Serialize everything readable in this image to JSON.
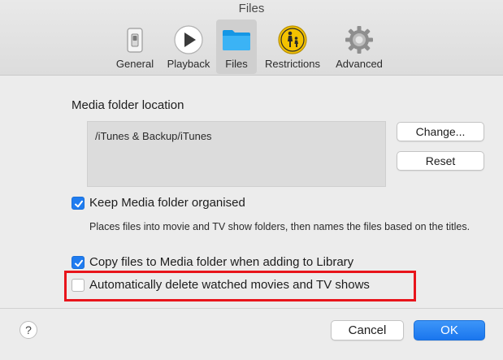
{
  "window": {
    "title": "Files"
  },
  "toolbar": {
    "tabs": [
      {
        "label": "General",
        "icon": "switch-icon"
      },
      {
        "label": "Playback",
        "icon": "play-icon"
      },
      {
        "label": "Files",
        "icon": "folder-icon",
        "selected": true
      },
      {
        "label": "Restrictions",
        "icon": "parental-restrictions-icon"
      },
      {
        "label": "Advanced",
        "icon": "gear-icon"
      }
    ]
  },
  "media_folder": {
    "label": "Media folder location",
    "path": "/iTunes & Backup/iTunes",
    "change_label": "Change...",
    "reset_label": "Reset"
  },
  "options": {
    "keep_organised": {
      "label": "Keep Media folder organised",
      "checked": true,
      "description": "Places files into movie and TV show folders, then names the files based on the titles."
    },
    "copy_files": {
      "label": "Copy files to Media folder when adding to Library",
      "checked": true
    },
    "auto_delete": {
      "label": "Automatically delete watched movies and TV shows",
      "checked": false
    }
  },
  "footer": {
    "help_label": "?",
    "cancel_label": "Cancel",
    "ok_label": "OK"
  },
  "colors": {
    "accent": "#1f7cf0",
    "highlight": "#e8141b"
  }
}
